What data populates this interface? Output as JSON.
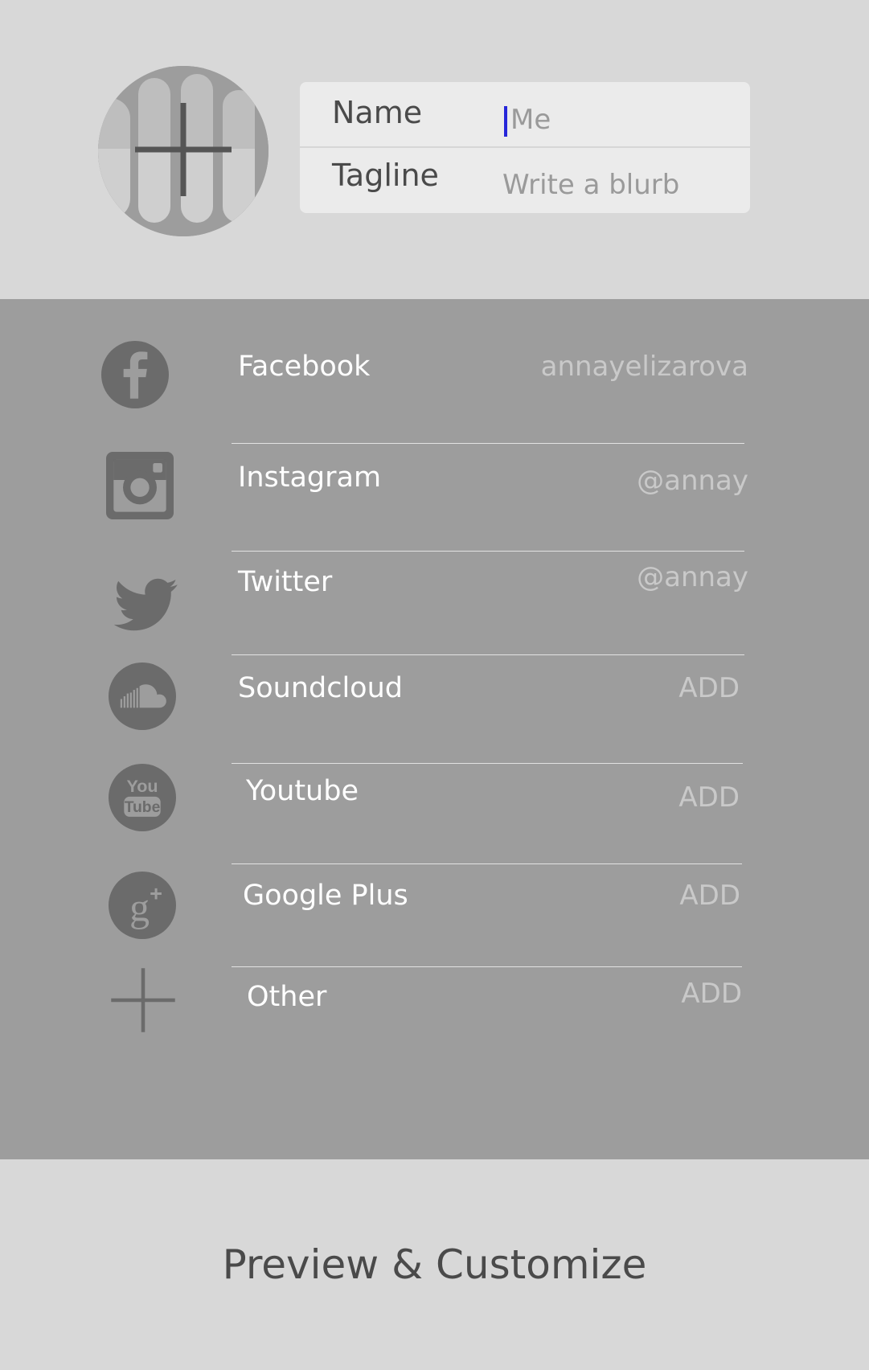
{
  "profile": {
    "name_label": "Name",
    "name_value": "Me",
    "tagline_label": "Tagline",
    "tagline_placeholder": "Write a blurb"
  },
  "socials": [
    {
      "icon": "facebook-icon",
      "label": "Facebook",
      "value": "annayelizarova"
    },
    {
      "icon": "instagram-icon",
      "label": "Instagram",
      "value": "@annay"
    },
    {
      "icon": "twitter-icon",
      "label": "Twitter",
      "value": "@annay"
    },
    {
      "icon": "soundcloud-icon",
      "label": "Soundcloud",
      "value": "ADD"
    },
    {
      "icon": "youtube-icon",
      "label": "Youtube",
      "value": "ADD"
    },
    {
      "icon": "google-plus-icon",
      "label": "Google Plus",
      "value": "ADD"
    },
    {
      "icon": "plus-icon",
      "label": "Other",
      "value": "ADD"
    }
  ],
  "icon_text": {
    "youtube_top": "You",
    "youtube_bottom": "Tube",
    "gplus": "g+"
  },
  "footer": {
    "preview_label": "Preview & Customize"
  },
  "colors": {
    "top_bg": "#d8d8d8",
    "social_bg": "#9d9d9d",
    "icon": "#6b6b6b",
    "caret": "#2626d9"
  }
}
